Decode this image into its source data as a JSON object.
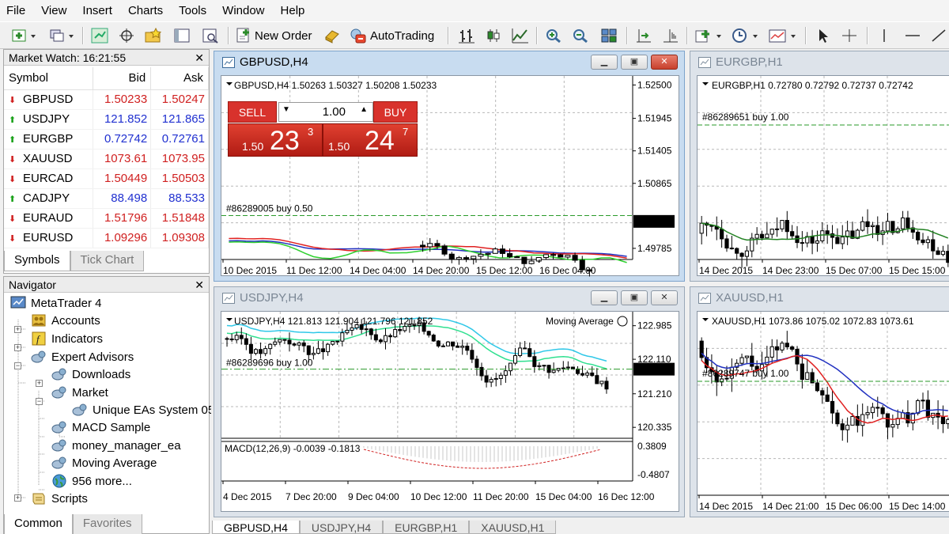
{
  "menu": [
    "File",
    "View",
    "Insert",
    "Charts",
    "Tools",
    "Window",
    "Help"
  ],
  "toolbar": {
    "new_order": "New Order",
    "autotrading": "AutoTrading"
  },
  "market_watch": {
    "title": "Market Watch: 16:21:55",
    "headers": {
      "symbol": "Symbol",
      "bid": "Bid",
      "ask": "Ask"
    },
    "rows": [
      {
        "symbol": "GBPUSD",
        "bid": "1.50233",
        "ask": "1.50247",
        "dir": "down"
      },
      {
        "symbol": "USDJPY",
        "bid": "121.852",
        "ask": "121.865",
        "dir": "up"
      },
      {
        "symbol": "EURGBP",
        "bid": "0.72742",
        "ask": "0.72761",
        "dir": "up"
      },
      {
        "symbol": "XAUUSD",
        "bid": "1073.61",
        "ask": "1073.95",
        "dir": "down"
      },
      {
        "symbol": "EURCAD",
        "bid": "1.50449",
        "ask": "1.50503",
        "dir": "down"
      },
      {
        "symbol": "CADJPY",
        "bid": "88.498",
        "ask": "88.533",
        "dir": "up"
      },
      {
        "symbol": "EURAUD",
        "bid": "1.51796",
        "ask": "1.51848",
        "dir": "down"
      },
      {
        "symbol": "EURUSD",
        "bid": "1.09296",
        "ask": "1.09308",
        "dir": "down"
      }
    ],
    "tabs": [
      "Symbols",
      "Tick Chart"
    ]
  },
  "navigator": {
    "title": "Navigator",
    "items": [
      {
        "label": "MetaTrader 4",
        "icon": "metatrader-icon"
      },
      {
        "label": "Accounts",
        "icon": "accounts-icon"
      },
      {
        "label": "Indicators",
        "icon": "indicators-icon"
      },
      {
        "label": "Expert Advisors",
        "icon": "expert-advisors-icon"
      },
      {
        "label": "Downloads",
        "icon": "expert-icon"
      },
      {
        "label": "Market",
        "icon": "expert-icon"
      },
      {
        "label": "Unique EAs System 05",
        "icon": "expert-icon"
      },
      {
        "label": "MACD Sample",
        "icon": "expert-icon"
      },
      {
        "label": "money_manager_ea",
        "icon": "expert-icon"
      },
      {
        "label": "Moving Average",
        "icon": "expert-icon"
      },
      {
        "label": "956 more...",
        "icon": "globe-icon"
      },
      {
        "label": "Scripts",
        "icon": "scripts-icon"
      }
    ],
    "tabs": [
      "Common",
      "Favorites"
    ]
  },
  "charts": {
    "gbpusd": {
      "title": "GBPUSD,H4",
      "info": "GBPUSD,H4  1.50263 1.50327 1.50208 1.50233",
      "prices": [
        "1.52500",
        "1.51945",
        "1.51405",
        "1.50865",
        "1.50233",
        "1.49785"
      ],
      "dates": [
        "10 Dec 2015",
        "11 Dec 12:00",
        "14 Dec 04:00",
        "14 Dec 20:00",
        "15 Dec 12:00",
        "16 Dec 04:00"
      ],
      "order_label": "#86289005 buy 0.50",
      "current": "1.50233",
      "trade": {
        "sell": "SELL",
        "buy": "BUY",
        "lot": "1.00",
        "sell_prefix": "1.50",
        "sell_big": "23",
        "sell_sup": "3",
        "buy_prefix": "1.50",
        "buy_big": "24",
        "buy_sup": "7"
      }
    },
    "eurgbp": {
      "title": "EURGBP,H1",
      "info": "EURGBP,H1  0.72780 0.72792 0.72737 0.72742",
      "dates": [
        "14 Dec 2015",
        "14 Dec 23:00",
        "15 Dec 07:00",
        "15 Dec 15:00"
      ],
      "order_label": "#86289651 buy 1.00"
    },
    "usdjpy": {
      "title": "USDJPY,H4",
      "info": "USDJPY,H4  121.813 121.904 121.796 121.852",
      "indicator": "Moving Average",
      "prices": [
        "122.985",
        "122.110",
        "121.852",
        "121.210",
        "120.335"
      ],
      "macd_label": "MACD(12,26,9) -0.0039 -0.1813",
      "macd_scale": [
        "0.3809",
        "-0.4807"
      ],
      "dates": [
        "4 Dec 2015",
        "7 Dec 20:00",
        "9 Dec 04:00",
        "10 Dec 12:00",
        "11 Dec 20:00",
        "15 Dec 04:00",
        "16 Dec 12:00"
      ],
      "order_label": "#86289696 buy 1.00",
      "current": "121.852"
    },
    "xauusd": {
      "title": "XAUUSD,H1",
      "info": "XAUUSD,H1  1073.86 1075.02 1072.83 1073.61",
      "dates": [
        "14 Dec 2015",
        "14 Dec 21:00",
        "15 Dec 06:00",
        "15 Dec 14:00"
      ],
      "order_label": "#86289747 buy 1.00"
    }
  },
  "bottom_tabs": [
    "GBPUSD,H4",
    "USDJPY,H4",
    "EURGBP,H1",
    "XAUUSD,H1"
  ]
}
